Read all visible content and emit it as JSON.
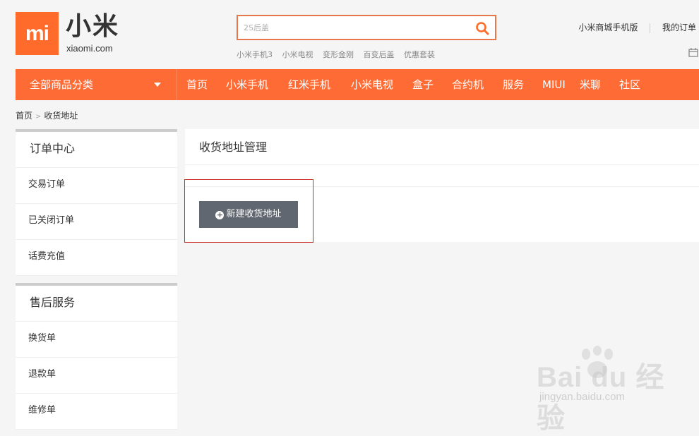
{
  "brand": {
    "logo_mark": "mi",
    "name_cn": "小米",
    "domain": "xiaomi.com",
    "color": "#ff6b2a"
  },
  "search": {
    "placeholder": "2S后盖",
    "icon": "search-icon"
  },
  "hot_words": [
    "小米手机3",
    "小米电视",
    "变形金刚",
    "百变后盖",
    "优惠套装"
  ],
  "top_links": {
    "mobile": "小米商城手机版",
    "orders": "我的订单"
  },
  "nav": {
    "category_label": "全部商品分类",
    "items": [
      "首页",
      "小米手机",
      "红米手机",
      "小米电视",
      "盒子",
      "合约机",
      "服务",
      "MIUI",
      "米聊",
      "社区"
    ]
  },
  "breadcrumb": {
    "home": "首页",
    "current": "收货地址"
  },
  "sidebar": {
    "groups": [
      {
        "title": "订单中心",
        "items": [
          "交易订单",
          "已关闭订单",
          "话费充值"
        ]
      },
      {
        "title": "售后服务",
        "items": [
          "换货单",
          "退款单",
          "维修单"
        ]
      }
    ]
  },
  "main": {
    "title": "收货地址管理",
    "new_button": "新建收货地址"
  },
  "watermark": {
    "text": "Bai du 经验",
    "sub": "jingyan.baidu.com"
  }
}
